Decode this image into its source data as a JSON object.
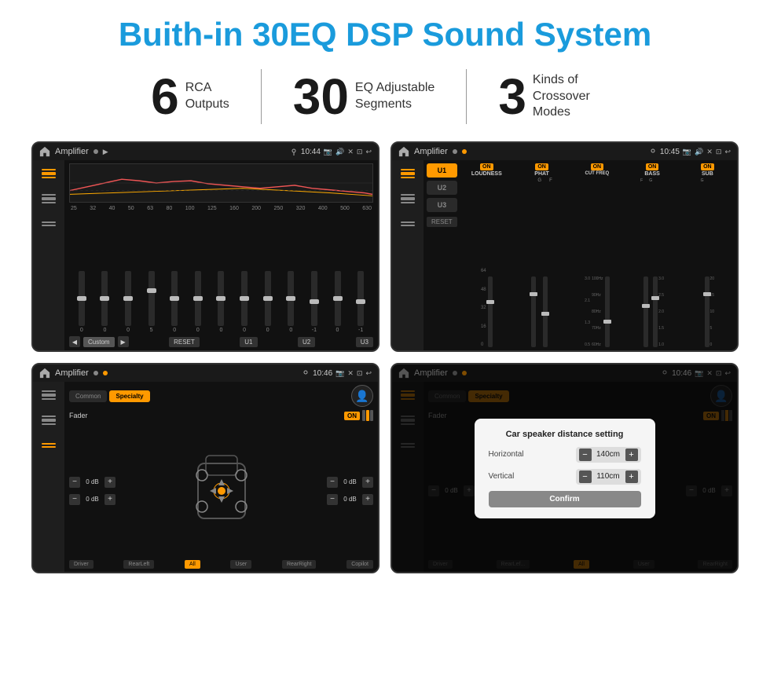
{
  "page": {
    "title": "Buith-in 30EQ DSP Sound System",
    "stats": [
      {
        "number": "6",
        "label": "RCA\nOutputs"
      },
      {
        "number": "30",
        "label": "EQ Adjustable\nSegments"
      },
      {
        "number": "3",
        "label": "Kinds of\nCrossover Modes"
      }
    ]
  },
  "screens": {
    "eq": {
      "title": "Amplifier",
      "time": "10:44",
      "freq_labels": [
        "25",
        "32",
        "40",
        "50",
        "63",
        "80",
        "100",
        "125",
        "160",
        "200",
        "250",
        "320",
        "400",
        "500",
        "630"
      ],
      "slider_values": [
        "0",
        "0",
        "0",
        "5",
        "0",
        "0",
        "0",
        "0",
        "0",
        "0",
        "-1",
        "0",
        "-1"
      ],
      "bottom_labels": [
        "Custom",
        "RESET",
        "U1",
        "U2",
        "U3"
      ]
    },
    "crossover": {
      "title": "Amplifier",
      "time": "10:45",
      "presets": [
        "U1",
        "U2",
        "U3"
      ],
      "channels": [
        "LOUDNESS",
        "PHAT",
        "CUT FREQ",
        "BASS",
        "SUB"
      ]
    },
    "fader": {
      "title": "Amplifier",
      "time": "10:46",
      "tabs": [
        "Common",
        "Specialty"
      ],
      "fader_label": "Fader",
      "zones": [
        "Driver",
        "RearLeft",
        "All",
        "User",
        "RearRight",
        "Copilot"
      ],
      "channel_values": [
        "0 dB",
        "0 dB",
        "0 dB",
        "0 dB"
      ]
    },
    "distance": {
      "title": "Amplifier",
      "time": "10:46",
      "dialog": {
        "title": "Car speaker distance setting",
        "horizontal_label": "Horizontal",
        "horizontal_value": "140cm",
        "vertical_label": "Vertical",
        "vertical_value": "110cm",
        "confirm_label": "Confirm"
      }
    }
  }
}
